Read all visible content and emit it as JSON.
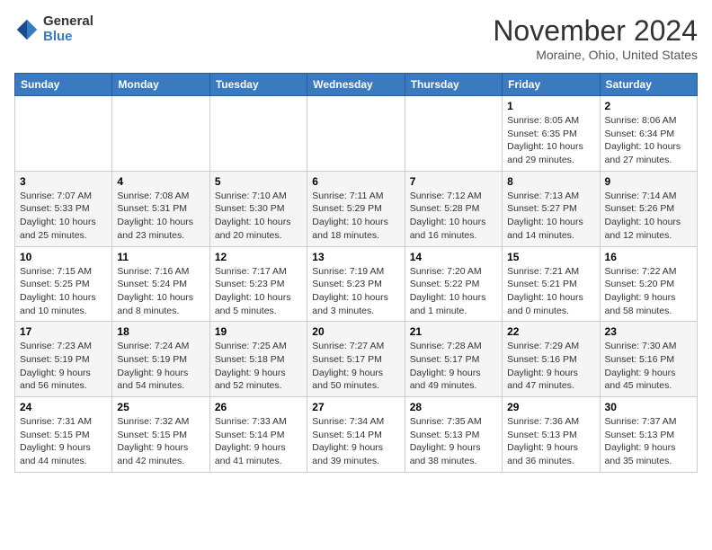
{
  "header": {
    "logo_general": "General",
    "logo_blue": "Blue",
    "month_title": "November 2024",
    "location": "Moraine, Ohio, United States"
  },
  "days_of_week": [
    "Sunday",
    "Monday",
    "Tuesday",
    "Wednesday",
    "Thursday",
    "Friday",
    "Saturday"
  ],
  "weeks": [
    [
      {
        "day": "",
        "info": ""
      },
      {
        "day": "",
        "info": ""
      },
      {
        "day": "",
        "info": ""
      },
      {
        "day": "",
        "info": ""
      },
      {
        "day": "",
        "info": ""
      },
      {
        "day": "1",
        "info": "Sunrise: 8:05 AM\nSunset: 6:35 PM\nDaylight: 10 hours and 29 minutes."
      },
      {
        "day": "2",
        "info": "Sunrise: 8:06 AM\nSunset: 6:34 PM\nDaylight: 10 hours and 27 minutes."
      }
    ],
    [
      {
        "day": "3",
        "info": "Sunrise: 7:07 AM\nSunset: 5:33 PM\nDaylight: 10 hours and 25 minutes."
      },
      {
        "day": "4",
        "info": "Sunrise: 7:08 AM\nSunset: 5:31 PM\nDaylight: 10 hours and 23 minutes."
      },
      {
        "day": "5",
        "info": "Sunrise: 7:10 AM\nSunset: 5:30 PM\nDaylight: 10 hours and 20 minutes."
      },
      {
        "day": "6",
        "info": "Sunrise: 7:11 AM\nSunset: 5:29 PM\nDaylight: 10 hours and 18 minutes."
      },
      {
        "day": "7",
        "info": "Sunrise: 7:12 AM\nSunset: 5:28 PM\nDaylight: 10 hours and 16 minutes."
      },
      {
        "day": "8",
        "info": "Sunrise: 7:13 AM\nSunset: 5:27 PM\nDaylight: 10 hours and 14 minutes."
      },
      {
        "day": "9",
        "info": "Sunrise: 7:14 AM\nSunset: 5:26 PM\nDaylight: 10 hours and 12 minutes."
      }
    ],
    [
      {
        "day": "10",
        "info": "Sunrise: 7:15 AM\nSunset: 5:25 PM\nDaylight: 10 hours and 10 minutes."
      },
      {
        "day": "11",
        "info": "Sunrise: 7:16 AM\nSunset: 5:24 PM\nDaylight: 10 hours and 8 minutes."
      },
      {
        "day": "12",
        "info": "Sunrise: 7:17 AM\nSunset: 5:23 PM\nDaylight: 10 hours and 5 minutes."
      },
      {
        "day": "13",
        "info": "Sunrise: 7:19 AM\nSunset: 5:23 PM\nDaylight: 10 hours and 3 minutes."
      },
      {
        "day": "14",
        "info": "Sunrise: 7:20 AM\nSunset: 5:22 PM\nDaylight: 10 hours and 1 minute."
      },
      {
        "day": "15",
        "info": "Sunrise: 7:21 AM\nSunset: 5:21 PM\nDaylight: 10 hours and 0 minutes."
      },
      {
        "day": "16",
        "info": "Sunrise: 7:22 AM\nSunset: 5:20 PM\nDaylight: 9 hours and 58 minutes."
      }
    ],
    [
      {
        "day": "17",
        "info": "Sunrise: 7:23 AM\nSunset: 5:19 PM\nDaylight: 9 hours and 56 minutes."
      },
      {
        "day": "18",
        "info": "Sunrise: 7:24 AM\nSunset: 5:19 PM\nDaylight: 9 hours and 54 minutes."
      },
      {
        "day": "19",
        "info": "Sunrise: 7:25 AM\nSunset: 5:18 PM\nDaylight: 9 hours and 52 minutes."
      },
      {
        "day": "20",
        "info": "Sunrise: 7:27 AM\nSunset: 5:17 PM\nDaylight: 9 hours and 50 minutes."
      },
      {
        "day": "21",
        "info": "Sunrise: 7:28 AM\nSunset: 5:17 PM\nDaylight: 9 hours and 49 minutes."
      },
      {
        "day": "22",
        "info": "Sunrise: 7:29 AM\nSunset: 5:16 PM\nDaylight: 9 hours and 47 minutes."
      },
      {
        "day": "23",
        "info": "Sunrise: 7:30 AM\nSunset: 5:16 PM\nDaylight: 9 hours and 45 minutes."
      }
    ],
    [
      {
        "day": "24",
        "info": "Sunrise: 7:31 AM\nSunset: 5:15 PM\nDaylight: 9 hours and 44 minutes."
      },
      {
        "day": "25",
        "info": "Sunrise: 7:32 AM\nSunset: 5:15 PM\nDaylight: 9 hours and 42 minutes."
      },
      {
        "day": "26",
        "info": "Sunrise: 7:33 AM\nSunset: 5:14 PM\nDaylight: 9 hours and 41 minutes."
      },
      {
        "day": "27",
        "info": "Sunrise: 7:34 AM\nSunset: 5:14 PM\nDaylight: 9 hours and 39 minutes."
      },
      {
        "day": "28",
        "info": "Sunrise: 7:35 AM\nSunset: 5:13 PM\nDaylight: 9 hours and 38 minutes."
      },
      {
        "day": "29",
        "info": "Sunrise: 7:36 AM\nSunset: 5:13 PM\nDaylight: 9 hours and 36 minutes."
      },
      {
        "day": "30",
        "info": "Sunrise: 7:37 AM\nSunset: 5:13 PM\nDaylight: 9 hours and 35 minutes."
      }
    ]
  ]
}
